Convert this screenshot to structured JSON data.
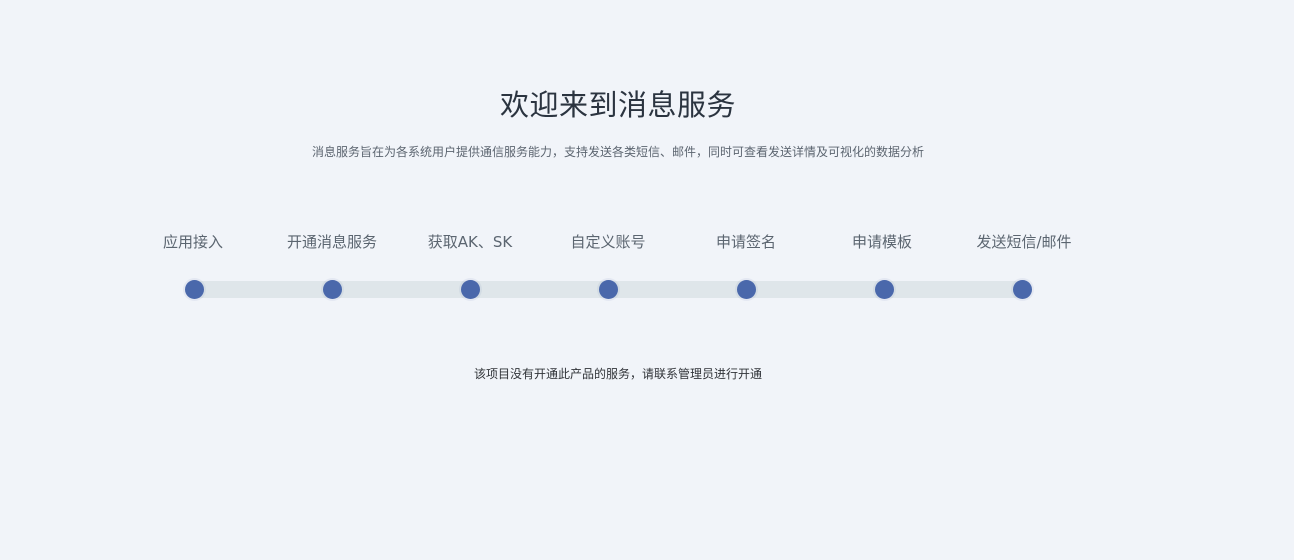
{
  "header": {
    "title": "欢迎来到消息服务",
    "subtitle": "消息服务旨在为各系统用户提供通信服务能力，支持发送各类短信、邮件，同时可查看发送详情及可视化的数据分析"
  },
  "steps": [
    {
      "label": "应用接入"
    },
    {
      "label": "开通消息服务"
    },
    {
      "label": "获取AK、SK"
    },
    {
      "label": "自定义账号"
    },
    {
      "label": "申请签名"
    },
    {
      "label": "申请模板"
    },
    {
      "label": "发送短信/邮件"
    }
  ],
  "notice": "该项目没有开通此产品的服务，请联系管理员进行开通",
  "colors": {
    "background": "#f1f4f9",
    "accent": "#4a68ab",
    "track": "#dfe6ea"
  }
}
